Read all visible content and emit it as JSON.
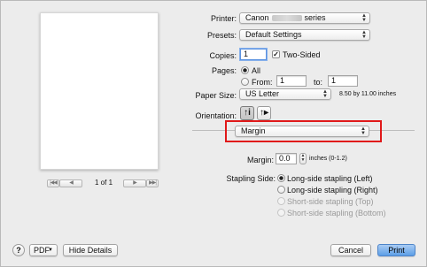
{
  "preview": {
    "first_btn": "|◀◀",
    "prev_btn": "◀",
    "page_counter": "1 of 1",
    "next_btn": "▶",
    "last_btn": "▶▶|"
  },
  "printer": {
    "label": "Printer:",
    "value_prefix": "Canon",
    "value_suffix": "series"
  },
  "presets": {
    "label": "Presets:",
    "value": "Default Settings"
  },
  "copies": {
    "label": "Copies:",
    "value": "1",
    "two_sided_label": "Two-Sided",
    "two_sided_checked": true
  },
  "pages": {
    "label": "Pages:",
    "all_label": "All",
    "from_label": "From:",
    "from_value": "1",
    "to_label": "to:",
    "to_value": "1"
  },
  "paper_size": {
    "label": "Paper Size:",
    "value": "US Letter",
    "dimensions": "8.50 by 11.00 inches"
  },
  "orientation": {
    "label": "Orientation:",
    "portrait_glyph": "↑i",
    "landscape_glyph": "↑▸"
  },
  "panel_selector": {
    "value": "Margin"
  },
  "margin": {
    "label": "Margin:",
    "value": "0.0",
    "units": "inches (0-1.2)"
  },
  "stapling": {
    "label": "Stapling Side:",
    "options": [
      {
        "label": "Long-side stapling (Left)"
      },
      {
        "label": "Long-side stapling (Right)"
      },
      {
        "label": "Short-side stapling (Top)"
      },
      {
        "label": "Short-side stapling (Bottom)"
      }
    ]
  },
  "footer": {
    "help": "?",
    "pdf": "PDF",
    "hide_details": "Hide Details",
    "cancel": "Cancel",
    "print": "Print"
  },
  "colors": {
    "highlight": "#e0191a",
    "default_button": "#5d9ee6"
  }
}
